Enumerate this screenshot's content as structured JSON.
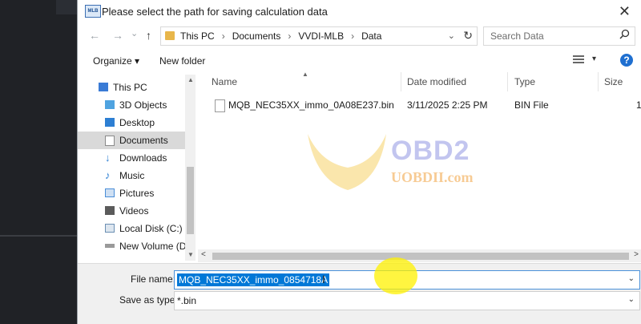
{
  "dialog": {
    "title": "Please select the path for saving calculation data",
    "app_icon_text": "MLB",
    "close_glyph": "✕"
  },
  "nav": {
    "back_glyph": "←",
    "forward_glyph": "→",
    "dropdown_glyph": "⌄",
    "up_glyph": "↑",
    "breadcrumbs": [
      "This PC",
      "Documents",
      "VVDI-MLB",
      "Data"
    ],
    "separator": "›",
    "refresh_glyph": "↻"
  },
  "search": {
    "placeholder": "Search Data",
    "icon": "search-icon"
  },
  "toolbar": {
    "organize_label": "Organize ▾",
    "new_folder_label": "New folder",
    "view_chevron": "▾",
    "help_label": "?"
  },
  "sidebar": {
    "items": [
      {
        "label": "This PC",
        "icon": "pc-icon",
        "color": "#3a7bd5"
      },
      {
        "label": "3D Objects",
        "icon": "3d-objects-icon",
        "color": "#4fa3e0"
      },
      {
        "label": "Desktop",
        "icon": "desktop-icon",
        "color": "#2d7fd3"
      },
      {
        "label": "Documents",
        "icon": "documents-icon",
        "color": "#8a8a8a",
        "selected": true
      },
      {
        "label": "Downloads",
        "icon": "downloads-icon",
        "color": "#2d7fd3"
      },
      {
        "label": "Music",
        "icon": "music-icon",
        "color": "#2d7fd3"
      },
      {
        "label": "Pictures",
        "icon": "pictures-icon",
        "color": "#4a8ed8"
      },
      {
        "label": "Videos",
        "icon": "videos-icon",
        "color": "#5b5b5b"
      },
      {
        "label": "Local Disk (C:)",
        "icon": "local-disk-icon",
        "color": "#6b8fb3"
      },
      {
        "label": "New Volume (D:",
        "icon": "volume-icon",
        "color": "#7a7a7a"
      }
    ]
  },
  "files": {
    "columns": [
      "Name",
      "Date modified",
      "Type",
      "Size"
    ],
    "rows": [
      {
        "name": "MQB_NEC35XX_immo_0A08E237.bin",
        "date": "3/11/2025 2:25 PM",
        "type": "BIN File",
        "size": "1"
      }
    ]
  },
  "scrollbar": {
    "left_glyph": "<",
    "right_glyph": ">",
    "up_glyph": "▲",
    "down_glyph": "▼"
  },
  "bottom": {
    "file_name_label": "File name:",
    "file_name_value": "MQB_NEC35XX_immo_0854718A",
    "save_as_label": "Save as type:",
    "save_as_value": "*.bin",
    "chevron": "⌄",
    "cursor_glyph": "I"
  },
  "watermark": {
    "brand": "OBD2",
    "url": "UOBDII.com"
  },
  "colors": {
    "accent": "#0078d7",
    "highlight": "#fff200",
    "selection_bg": "#d9d9d9"
  }
}
